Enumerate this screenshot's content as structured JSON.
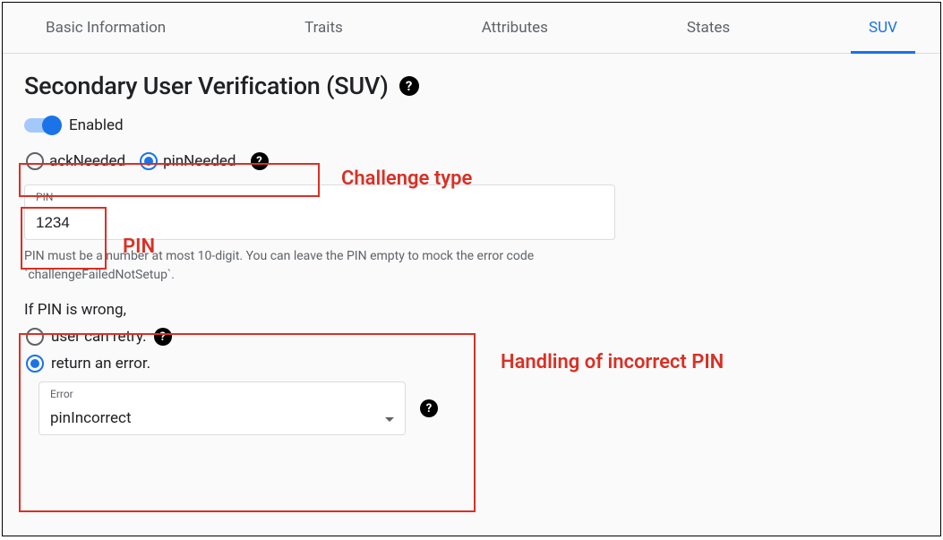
{
  "tabs": [
    {
      "label": "Basic Information",
      "active": false
    },
    {
      "label": "Traits",
      "active": false
    },
    {
      "label": "Attributes",
      "active": false
    },
    {
      "label": "States",
      "active": false
    },
    {
      "label": "SUV",
      "active": true
    }
  ],
  "heading": "Secondary User Verification (SUV)",
  "toggle": {
    "enabled": true,
    "label": "Enabled"
  },
  "challengeType": {
    "options": [
      {
        "label": "ackNeeded",
        "selected": false
      },
      {
        "label": "pinNeeded",
        "selected": true
      }
    ]
  },
  "pinField": {
    "label": "PIN",
    "value": "1234",
    "hint": "PIN must be a number at most 10-digit. You can leave the PIN empty to mock the error code `challengeFailedNotSetup`."
  },
  "wrongPin": {
    "label": "If PIN is wrong,",
    "options": [
      {
        "label": "user can retry.",
        "selected": false,
        "hasHelp": true
      },
      {
        "label": "return an error.",
        "selected": true,
        "hasHelp": false
      }
    ],
    "errorSelect": {
      "label": "Error",
      "value": "pinIncorrect"
    }
  },
  "annotations": {
    "challengeType": "Challenge type",
    "pin": "PIN",
    "handling": "Handling of incorrect PIN"
  }
}
